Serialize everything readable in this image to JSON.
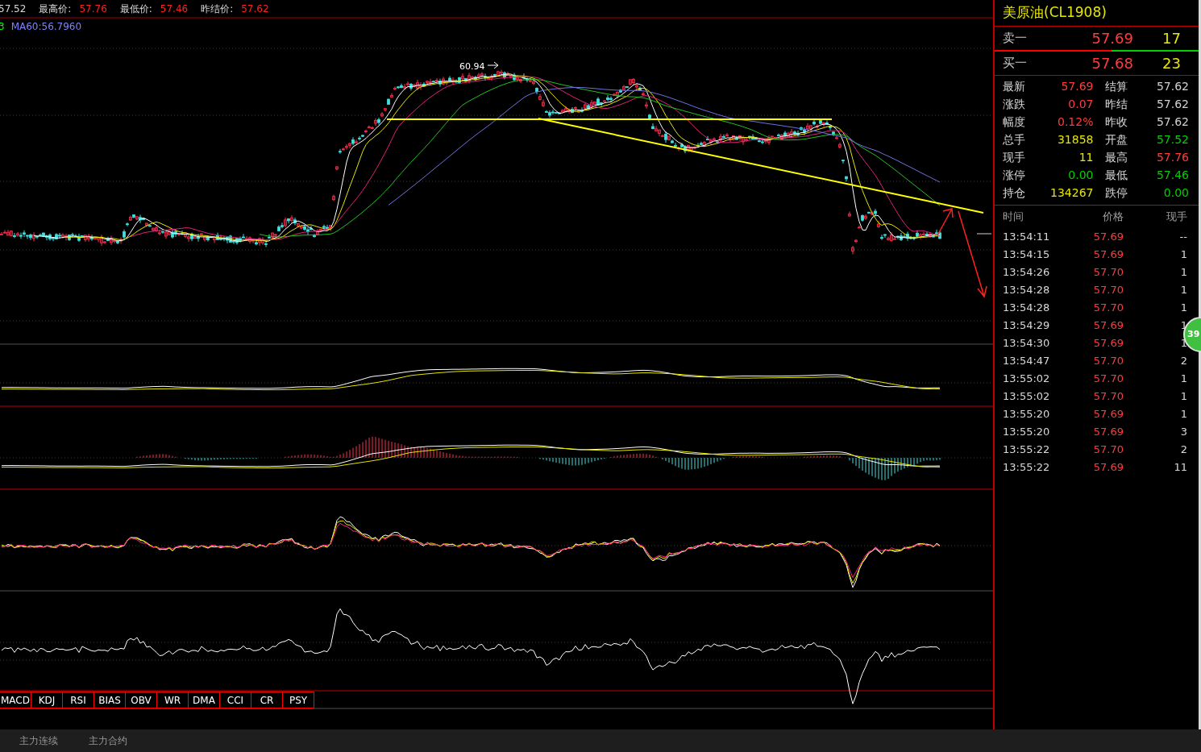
{
  "header": {
    "open_value": "57.52",
    "stats": [
      {
        "label": "最高价:",
        "value": "57.76"
      },
      {
        "label": "最低价:",
        "value": "57.46"
      },
      {
        "label": "昨结价:",
        "value": "57.62"
      }
    ]
  },
  "ma_legend": [
    {
      "text": "3",
      "color": "#00ff00"
    },
    {
      "text": "MA60:56.7960",
      "color": "#8080ff"
    }
  ],
  "chart": {
    "peak_label": "60.94"
  },
  "indicator_tabs": [
    "MACD",
    "KDJ",
    "RSI",
    "BIAS",
    "OBV",
    "WR",
    "DMA",
    "CCI",
    "CR",
    "PSY"
  ],
  "quote": {
    "title": "美原油(CL1908)",
    "ask": {
      "label": "卖一",
      "price": "57.69",
      "volume": "17"
    },
    "bid": {
      "label": "买一",
      "price": "57.68",
      "volume": "23"
    },
    "stats": [
      {
        "label": "最新",
        "value": "57.69",
        "color": "#ff3c3c"
      },
      {
        "label": "结算",
        "value": "57.62",
        "color": "#d0d0d0"
      },
      {
        "label": "涨跌",
        "value": "0.07",
        "color": "#ff3c3c"
      },
      {
        "label": "昨结",
        "value": "57.62",
        "color": "#d0d0d0"
      },
      {
        "label": "幅度",
        "value": "0.12%",
        "color": "#ff3c3c"
      },
      {
        "label": "昨收",
        "value": "57.62",
        "color": "#d0d0d0"
      },
      {
        "label": "总手",
        "value": "31858",
        "color": "#e6e600"
      },
      {
        "label": "开盘",
        "value": "57.52",
        "color": "#00d000"
      },
      {
        "label": "现手",
        "value": "11",
        "color": "#e6e600"
      },
      {
        "label": "最高",
        "value": "57.76",
        "color": "#ff3c3c"
      },
      {
        "label": "涨停",
        "value": "0.00",
        "color": "#00d000"
      },
      {
        "label": "最低",
        "value": "57.46",
        "color": "#00d000"
      },
      {
        "label": "持仓",
        "value": "134267",
        "color": "#e6e600"
      },
      {
        "label": "跌停",
        "value": "0.00",
        "color": "#00d000"
      }
    ]
  },
  "trades": {
    "columns": [
      "时间",
      "价格",
      "现手"
    ],
    "rows": [
      {
        "time": "13:54:11",
        "price": "57.69",
        "volume": "--"
      },
      {
        "time": "13:54:15",
        "price": "57.69",
        "volume": "1"
      },
      {
        "time": "13:54:26",
        "price": "57.70",
        "volume": "1"
      },
      {
        "time": "13:54:28",
        "price": "57.70",
        "volume": "1"
      },
      {
        "time": "13:54:28",
        "price": "57.70",
        "volume": "1"
      },
      {
        "time": "13:54:29",
        "price": "57.69",
        "volume": "1"
      },
      {
        "time": "13:54:30",
        "price": "57.69",
        "volume": "1"
      },
      {
        "time": "13:54:47",
        "price": "57.70",
        "volume": "2"
      },
      {
        "time": "13:55:02",
        "price": "57.70",
        "volume": "1"
      },
      {
        "time": "13:55:02",
        "price": "57.70",
        "volume": "1"
      },
      {
        "time": "13:55:20",
        "price": "57.69",
        "volume": "1"
      },
      {
        "time": "13:55:20",
        "price": "57.69",
        "volume": "3"
      },
      {
        "time": "13:55:22",
        "price": "57.70",
        "volume": "2"
      },
      {
        "time": "13:55:22",
        "price": "57.69",
        "volume": "11"
      }
    ]
  },
  "float_badge": "39",
  "bottom_tabs": [
    "主力连续",
    "主力合约"
  ]
}
